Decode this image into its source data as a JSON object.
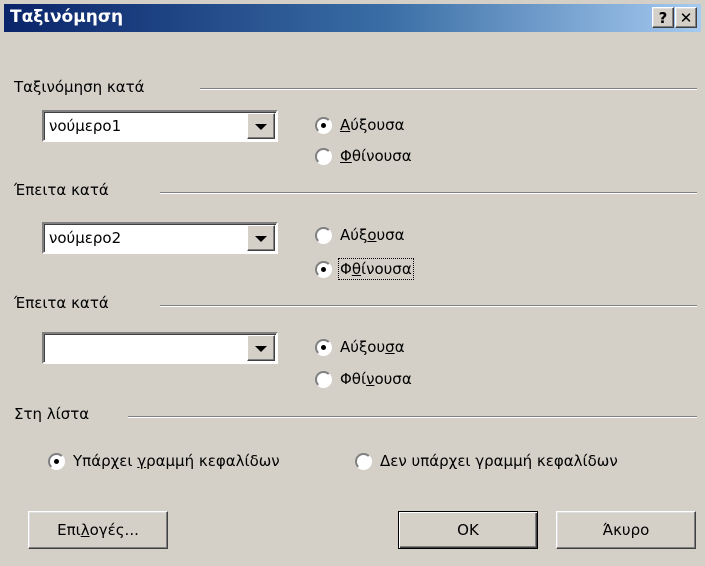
{
  "dialog": {
    "title": "Ταξινόμηση",
    "help_button": "?",
    "close_button": "✕"
  },
  "sort_by": {
    "group_label": "Ταξινόμηση κατά",
    "combo_value": "νούμερο1",
    "ascending": {
      "pre": "",
      "u": "Α",
      "post": "ύξουσα",
      "checked": true
    },
    "descending": {
      "pre": "",
      "u": "Φ",
      "post": "θίνουσα",
      "checked": false
    }
  },
  "then_by_1": {
    "group_label": "Έπειτα κατά",
    "combo_value": "νούμερο2",
    "ascending": {
      "pre": "Αύξ",
      "u": "ο",
      "post": "υσα",
      "checked": false
    },
    "descending": {
      "pre": "Φ",
      "u": "θ",
      "post": "ίνουσα",
      "checked": true
    }
  },
  "then_by_2": {
    "group_label": "Έπειτα κατά",
    "combo_value": "",
    "ascending": {
      "pre": "Αύξου",
      "u": "σ",
      "post": "α",
      "checked": true
    },
    "descending": {
      "pre": "Φθί",
      "u": "ν",
      "post": "ουσα",
      "checked": false
    }
  },
  "list": {
    "group_label": "Στη λίστα",
    "header_row": {
      "pre": "Υπάρχει ",
      "u": "γ",
      "post": "ραμμή κεφαλίδων",
      "checked": true
    },
    "no_header_row": {
      "pre": "Δεν υπάρ",
      "u": "χ",
      "post": "ει γραμμή κεφαλίδων",
      "checked": false
    }
  },
  "buttons": {
    "options": {
      "pre": "Επι",
      "u": "λ",
      "post": "ογές..."
    },
    "ok": "OK",
    "cancel": "Άκυρο"
  }
}
